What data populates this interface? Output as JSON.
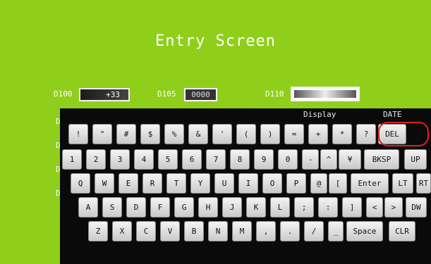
{
  "screen": {
    "title": "Entry Screen"
  },
  "fields": {
    "d100": {
      "label": "D100",
      "value": "+33"
    },
    "d105": {
      "label": "D105",
      "value": "0000"
    },
    "d110": {
      "label": "D110"
    }
  },
  "side_labels": [
    "D",
    "D",
    "D",
    "D"
  ],
  "keyboard": {
    "display_label": "Display",
    "date_label": "DATE",
    "row1": [
      "!",
      "\"",
      "#",
      "$",
      "%",
      "&",
      "'",
      "(",
      ")",
      "=",
      "+",
      "*",
      "?",
      "DEL"
    ],
    "row2": [
      "1",
      "2",
      "3",
      "4",
      "5",
      "6",
      "7",
      "8",
      "9",
      "0",
      "-",
      "^",
      "¥",
      "BKSP",
      "UP"
    ],
    "row3": [
      "Q",
      "W",
      "E",
      "R",
      "T",
      "Y",
      "U",
      "I",
      "O",
      "P",
      "@",
      "[",
      "Enter",
      "LT",
      "RT"
    ],
    "row4": [
      "A",
      "S",
      "D",
      "F",
      "G",
      "H",
      "J",
      "K",
      "L",
      ";",
      ":",
      "]",
      "<",
      ">",
      "DW"
    ],
    "row5": [
      "Z",
      "X",
      "C",
      "V",
      "B",
      "N",
      "M",
      ",",
      ".",
      "/",
      "_",
      "Space",
      "CLR"
    ]
  },
  "colors": {
    "background": "#8fcf1b",
    "keyboard": "#0a0a0a",
    "highlight": "#e02020"
  }
}
